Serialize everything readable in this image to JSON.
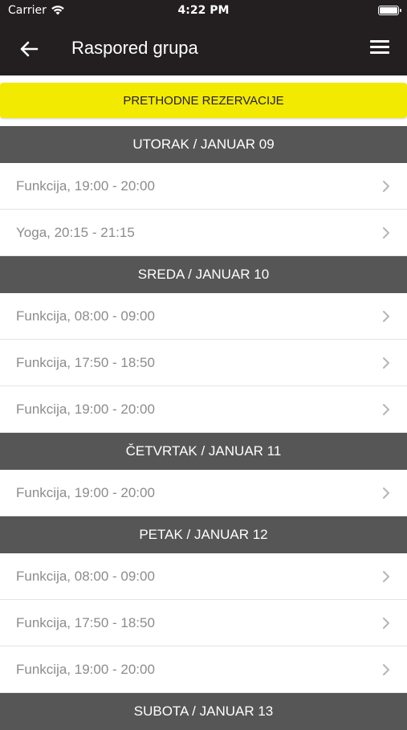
{
  "status": {
    "carrier": "Carrier",
    "time": "4:22 PM"
  },
  "nav": {
    "title": "Raspored grupa"
  },
  "prev_button": "PRETHODNE REZERVACIJE",
  "days": [
    {
      "header": "UTORAK / JANUAR 09",
      "items": [
        "Funkcija, 19:00 - 20:00",
        "Yoga, 20:15 - 21:15"
      ]
    },
    {
      "header": "SREDA / JANUAR 10",
      "items": [
        "Funkcija, 08:00 - 09:00",
        "Funkcija, 17:50 - 18:50",
        "Funkcija, 19:00 - 20:00"
      ]
    },
    {
      "header": "ČETVRTAK / JANUAR 11",
      "items": [
        "Funkcija, 19:00 - 20:00"
      ]
    },
    {
      "header": "PETAK / JANUAR 12",
      "items": [
        "Funkcija, 08:00 - 09:00",
        "Funkcija, 17:50 - 18:50",
        "Funkcija, 19:00 - 20:00"
      ]
    },
    {
      "header": "SUBOTA / JANUAR 13",
      "items": []
    }
  ]
}
